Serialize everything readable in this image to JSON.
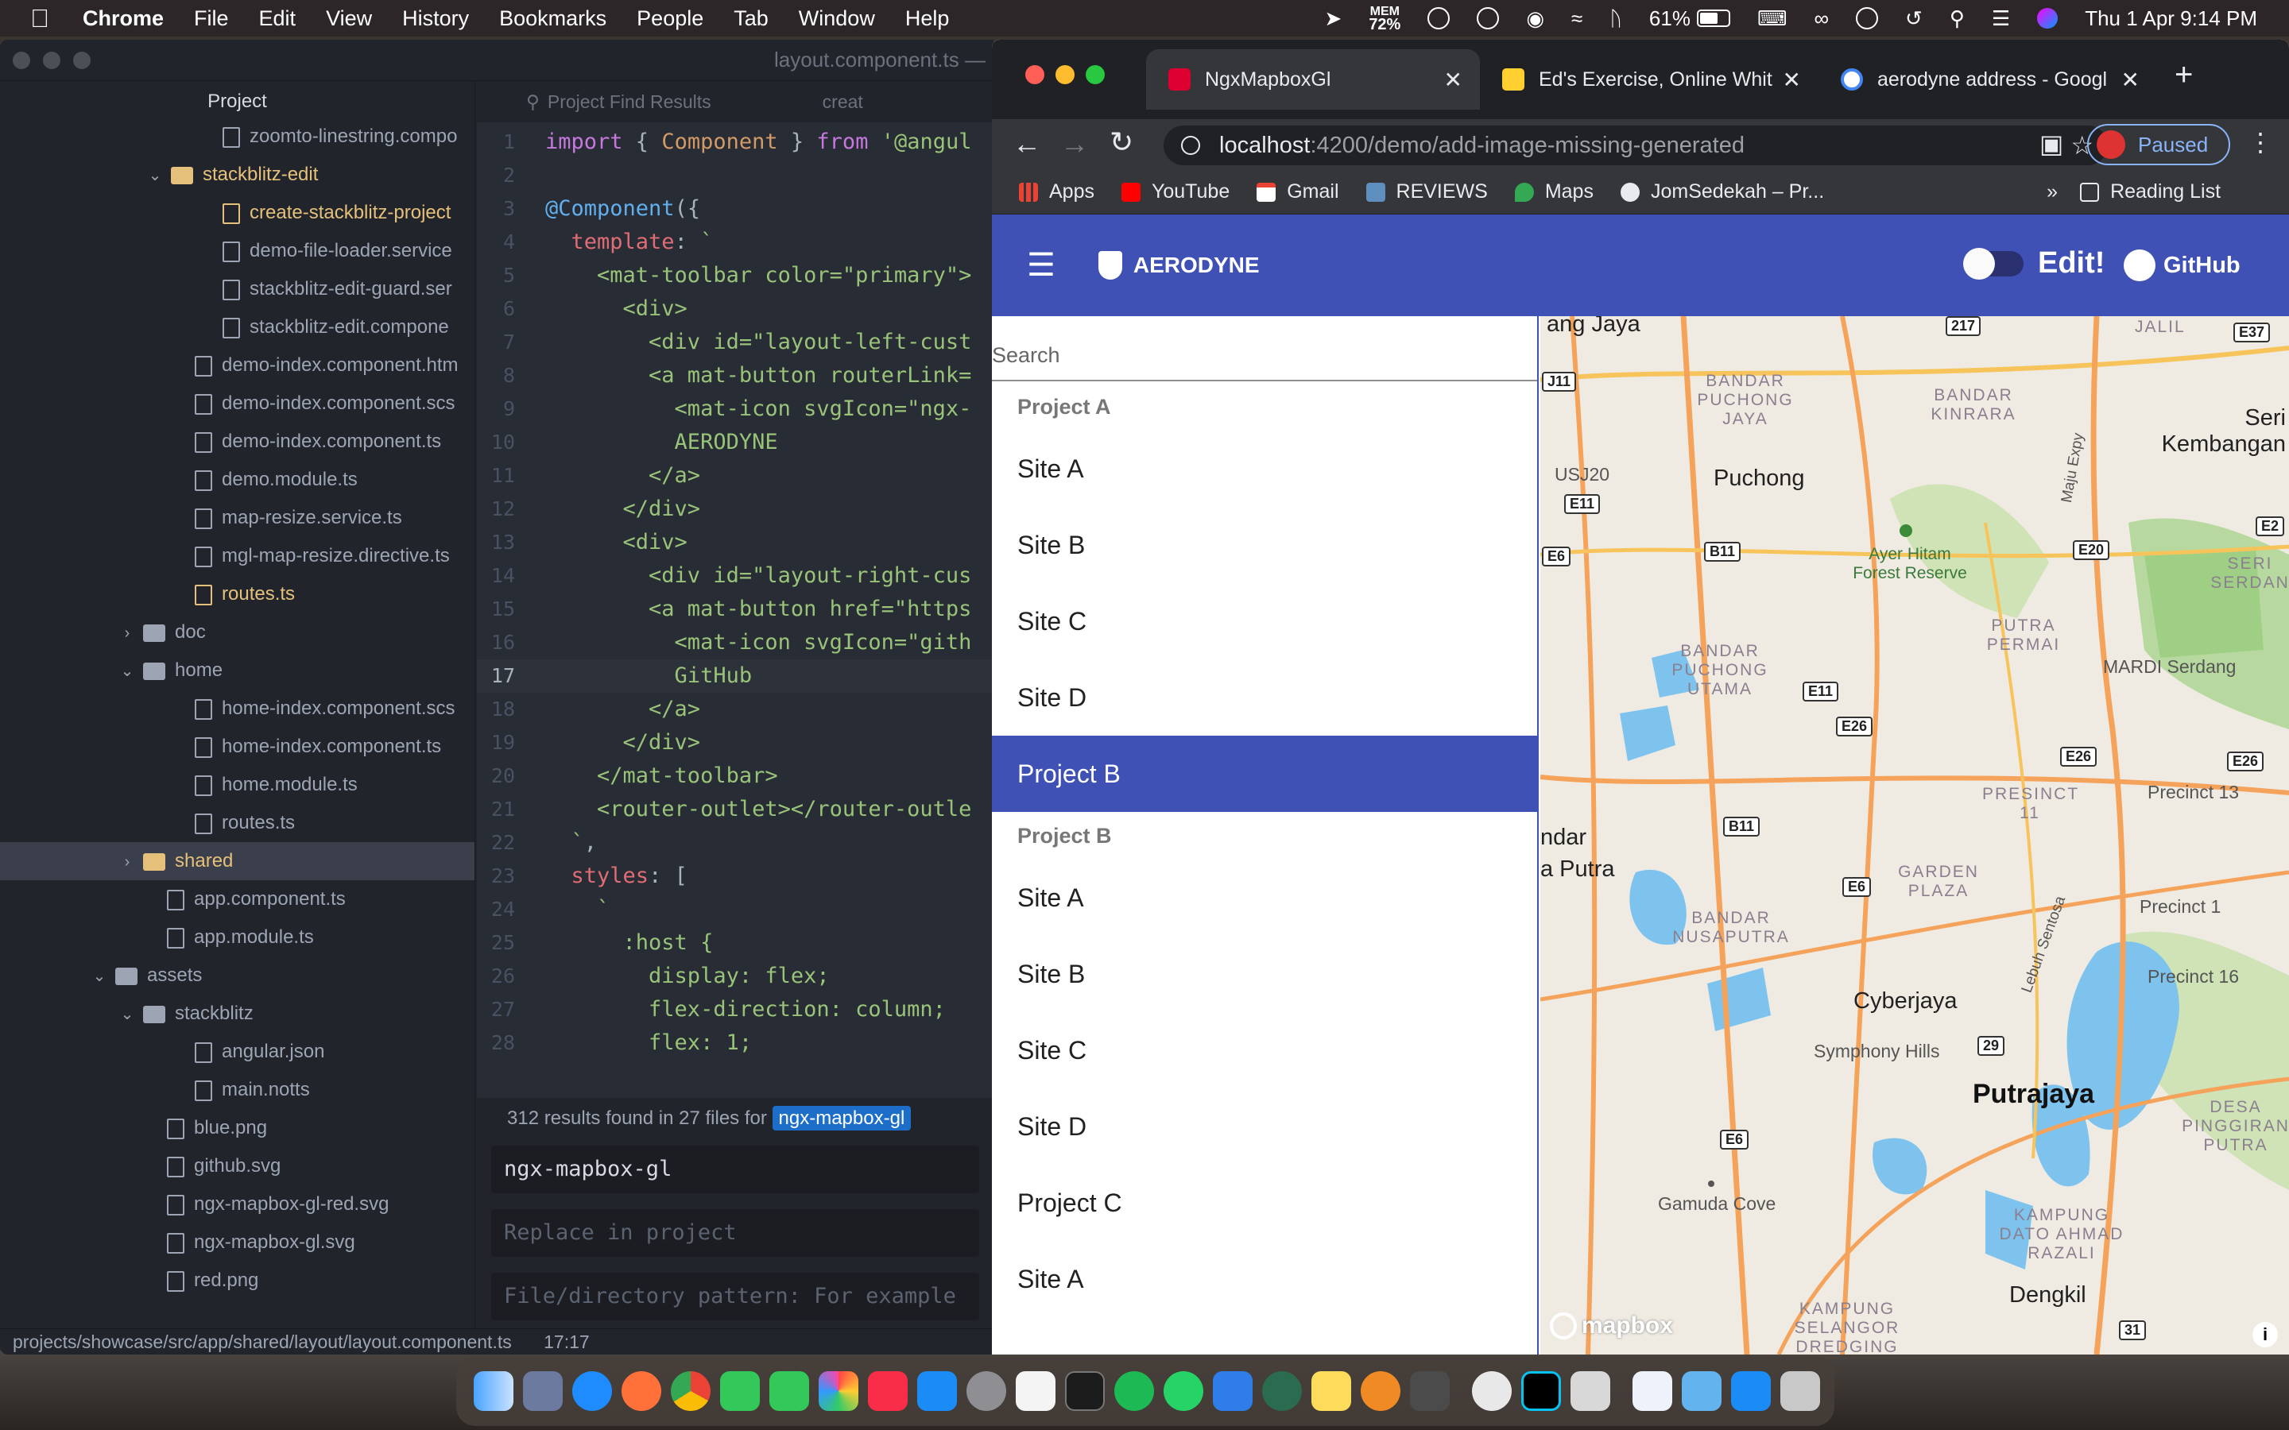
{
  "menubar": {
    "app": "Chrome",
    "items": [
      "File",
      "Edit",
      "View",
      "History",
      "Bookmarks",
      "People",
      "Tab",
      "Window",
      "Help"
    ],
    "mem_label": "MEM",
    "mem_value": "72%",
    "battery": "61%",
    "clock": "Thu 1 Apr  9:14 PM"
  },
  "atom": {
    "window_title": "layout.component.ts —",
    "tree_header": "Project",
    "tree": [
      {
        "label": "zoomto-linestring.compo",
        "kind": "file",
        "indent": 280,
        "yel": false
      },
      {
        "label": "stackblitz-edit",
        "kind": "folder-open",
        "indent": 215,
        "yel": true
      },
      {
        "label": "create-stackblitz-project",
        "kind": "file",
        "indent": 280,
        "yel": true
      },
      {
        "label": "demo-file-loader.service",
        "kind": "file",
        "indent": 280,
        "yel": false
      },
      {
        "label": "stackblitz-edit-guard.ser",
        "kind": "file",
        "indent": 280,
        "yel": false
      },
      {
        "label": "stackblitz-edit.compone",
        "kind": "file",
        "indent": 280,
        "yel": false
      },
      {
        "label": "demo-index.component.htm",
        "kind": "file",
        "indent": 245,
        "yel": false
      },
      {
        "label": "demo-index.component.scs",
        "kind": "file",
        "indent": 245,
        "yel": false
      },
      {
        "label": "demo-index.component.ts",
        "kind": "file",
        "indent": 245,
        "yel": false
      },
      {
        "label": "demo.module.ts",
        "kind": "file",
        "indent": 245,
        "yel": false
      },
      {
        "label": "map-resize.service.ts",
        "kind": "file",
        "indent": 245,
        "yel": false
      },
      {
        "label": "mgl-map-resize.directive.ts",
        "kind": "file",
        "indent": 245,
        "yel": false
      },
      {
        "label": "routes.ts",
        "kind": "file",
        "indent": 245,
        "yel": true
      },
      {
        "label": "doc",
        "kind": "folder-closed",
        "indent": 180,
        "yel": false
      },
      {
        "label": "home",
        "kind": "folder-open",
        "indent": 180,
        "yel": false
      },
      {
        "label": "home-index.component.scs",
        "kind": "file",
        "indent": 245,
        "yel": false
      },
      {
        "label": "home-index.component.ts",
        "kind": "file",
        "indent": 245,
        "yel": false
      },
      {
        "label": "home.module.ts",
        "kind": "file",
        "indent": 245,
        "yel": false
      },
      {
        "label": "routes.ts",
        "kind": "file",
        "indent": 245,
        "yel": false
      },
      {
        "label": "shared",
        "kind": "folder-closed",
        "indent": 180,
        "yel": true,
        "sel": true
      },
      {
        "label": "app.component.ts",
        "kind": "file",
        "indent": 210,
        "yel": false
      },
      {
        "label": "app.module.ts",
        "kind": "file",
        "indent": 210,
        "yel": false
      },
      {
        "label": "assets",
        "kind": "folder-open",
        "indent": 145,
        "yel": false
      },
      {
        "label": "stackblitz",
        "kind": "folder-open",
        "indent": 180,
        "yel": false
      },
      {
        "label": "angular.json",
        "kind": "file",
        "indent": 245,
        "yel": false
      },
      {
        "label": "main.notts",
        "kind": "file",
        "indent": 245,
        "yel": false
      },
      {
        "label": "blue.png",
        "kind": "file",
        "indent": 210,
        "yel": false
      },
      {
        "label": "github.svg",
        "kind": "file",
        "indent": 210,
        "yel": false
      },
      {
        "label": "ngx-mapbox-gl-red.svg",
        "kind": "file",
        "indent": 210,
        "yel": false
      },
      {
        "label": "ngx-mapbox-gl.svg",
        "kind": "file",
        "indent": 210,
        "yel": false
      },
      {
        "label": "red.png",
        "kind": "file",
        "indent": 210,
        "yel": false
      }
    ],
    "editor_tab_find": "Project Find Results",
    "editor_tab_other": "creat",
    "code": [
      {
        "n": "1",
        "html": "<span class='kw'>import</span> { <span class='at'>Component</span> } <span class='kw'>from</span> <span class='st'>'@angul</span>"
      },
      {
        "n": "2",
        "html": ""
      },
      {
        "n": "3",
        "html": "<span class='fn'>@Component</span>({"
      },
      {
        "n": "4",
        "html": "  <span class='tg'>template</span>: <span class='st'>`</span>"
      },
      {
        "n": "5",
        "html": "<span class='st'>    &lt;mat-toolbar color=\"primary\"&gt;</span>"
      },
      {
        "n": "6",
        "html": "<span class='st'>      &lt;div&gt;</span>"
      },
      {
        "n": "7",
        "html": "<span class='st'>        &lt;div id=\"layout-left-cust</span>"
      },
      {
        "n": "8",
        "html": "<span class='st'>        &lt;a mat-button routerLink=</span>"
      },
      {
        "n": "9",
        "html": "<span class='st'>          &lt;mat-icon svgIcon=\"ngx-</span>"
      },
      {
        "n": "10",
        "html": "<span class='st'>          AERODYNE</span>"
      },
      {
        "n": "11",
        "html": "<span class='st'>        &lt;/a&gt;</span>"
      },
      {
        "n": "12",
        "html": "<span class='st'>      &lt;/div&gt;</span>"
      },
      {
        "n": "13",
        "html": "<span class='st'>      &lt;div&gt;</span>"
      },
      {
        "n": "14",
        "html": "<span class='st'>        &lt;div id=\"layout-right-cus</span>"
      },
      {
        "n": "15",
        "html": "<span class='st'>        &lt;a mat-button href=\"https</span>"
      },
      {
        "n": "16",
        "html": "<span class='st'>          &lt;mat-icon svgIcon=\"gith</span>"
      },
      {
        "n": "17",
        "html": "<span class='st'>          GitHub</span>",
        "cur": true
      },
      {
        "n": "18",
        "html": "<span class='st'>        &lt;/a&gt;</span>"
      },
      {
        "n": "19",
        "html": "<span class='st'>      &lt;/div&gt;</span>"
      },
      {
        "n": "20",
        "html": "<span class='st'>    &lt;/mat-toolbar&gt;</span>"
      },
      {
        "n": "21",
        "html": "<span class='st'>    &lt;router-outlet&gt;&lt;/router-outle</span>"
      },
      {
        "n": "22",
        "html": "<span class='st'>  `</span>,"
      },
      {
        "n": "23",
        "html": "  <span class='tg'>styles</span>: ["
      },
      {
        "n": "24",
        "html": "    <span class='st'>`</span>"
      },
      {
        "n": "25",
        "html": "<span class='st'>      :host {</span>"
      },
      {
        "n": "26",
        "html": "<span class='st'>        display: flex;</span>"
      },
      {
        "n": "27",
        "html": "<span class='st'>        flex-direction: column;</span>"
      },
      {
        "n": "28",
        "html": "<span class='st'>        flex: 1;</span>"
      }
    ],
    "find_summary": "312 results found in 27 files for",
    "find_term": "ngx-mapbox-gl",
    "find_input": "ngx-mapbox-gl",
    "replace_placeholder": "Replace in project",
    "pattern_placeholder": "File/directory pattern: For example `",
    "status_path": "projects/showcase/src/app/shared/layout/layout.component.ts",
    "status_pos": "17:17"
  },
  "chrome": {
    "tabs": [
      {
        "title": "NgxMapboxGl",
        "active": true
      },
      {
        "title": "Ed's Exercise, Online Whit",
        "active": false
      },
      {
        "title": "aerodyne address - Googl",
        "active": false
      }
    ],
    "url_host": "localhost",
    "url_path": ":4200/demo/add-image-missing-generated",
    "profile_status": "Paused",
    "bookmarks": [
      "Apps",
      "YouTube",
      "Gmail",
      "REVIEWS",
      "Maps",
      "JomSedekah – Pr..."
    ],
    "bookmarks_more": "»",
    "reading_list": "Reading List"
  },
  "app": {
    "brand": "AERODYNE",
    "edit_label": "Edit!",
    "github_label": "GitHub",
    "search_placeholder": "Search",
    "list": [
      {
        "label": "Project A",
        "type": "group"
      },
      {
        "label": "Site A",
        "type": "item"
      },
      {
        "label": "Site B",
        "type": "item"
      },
      {
        "label": "Site C",
        "type": "item"
      },
      {
        "label": "Site D",
        "type": "item"
      },
      {
        "label": "Project B",
        "type": "active"
      },
      {
        "label": "Project B",
        "type": "group"
      },
      {
        "label": "Site A",
        "type": "item"
      },
      {
        "label": "Site B",
        "type": "item"
      },
      {
        "label": "Site C",
        "type": "item"
      },
      {
        "label": "Site D",
        "type": "item"
      },
      {
        "label": "Project C",
        "type": "item"
      },
      {
        "label": "Site A",
        "type": "item"
      }
    ]
  },
  "map": {
    "labels": {
      "bang_jaya": "ang Jaya",
      "puchong": "Puchong",
      "bandar_puchong_jaya": "BANDAR PUCHONG JAYA",
      "bandar_kinrara": "BANDAR KINRARA",
      "seri_kembangan": "Seri Kembangan",
      "ayer_hitam": "Ayer Hitam Forest Reserve",
      "bandar_puchong_utama": "BANDAR PUCHONG UTAMA",
      "putra_permai": "PUTRA PERMAI",
      "mardi": "MARDI Serdang",
      "seri_serdang": "SERI SERDAN",
      "presint11": "PRESINCT 11",
      "precinct13": "Precinct 13",
      "andar": "ndar",
      "a_putra": "a Putra",
      "garden_plaza": "GARDEN PLAZA",
      "bandar_nusaputra": "BANDAR NUSAPUTRA",
      "precinct1": "Precinct 1",
      "precinct16": "Precinct 16",
      "cyberjaya": "Cyberjaya",
      "symphony": "Symphony Hills",
      "putrajaya": "Putrajaya",
      "desa": "DESA PINGGIRAN PUTRA",
      "gamuda": "Gamuda Cove",
      "kampung_dato": "KAMPUNG DATO AHMAD RAZALI",
      "dengkil": "Dengkil",
      "kampung_selangor": "KAMPUNG SELANGOR DREDGING",
      "lebuh": "Lebuh Sentosa",
      "maju": "Maju Expy",
      "usj20": "USJ20",
      "jalil": "JALIL",
      "logo": "mapbox"
    },
    "shields": {
      "j11": "J11",
      "e11a": "E11",
      "b11a": "B11",
      "e6a": "E6",
      "e20": "E20",
      "e2": "E2",
      "e11b": "E11",
      "e26a": "E26",
      "e26b": "E26",
      "e26c": "E26",
      "b11b": "B11",
      "e6b": "E6",
      "r29": "29",
      "e6c": "E6",
      "r31": "31",
      "e37": "E37",
      "r217": "217"
    }
  }
}
